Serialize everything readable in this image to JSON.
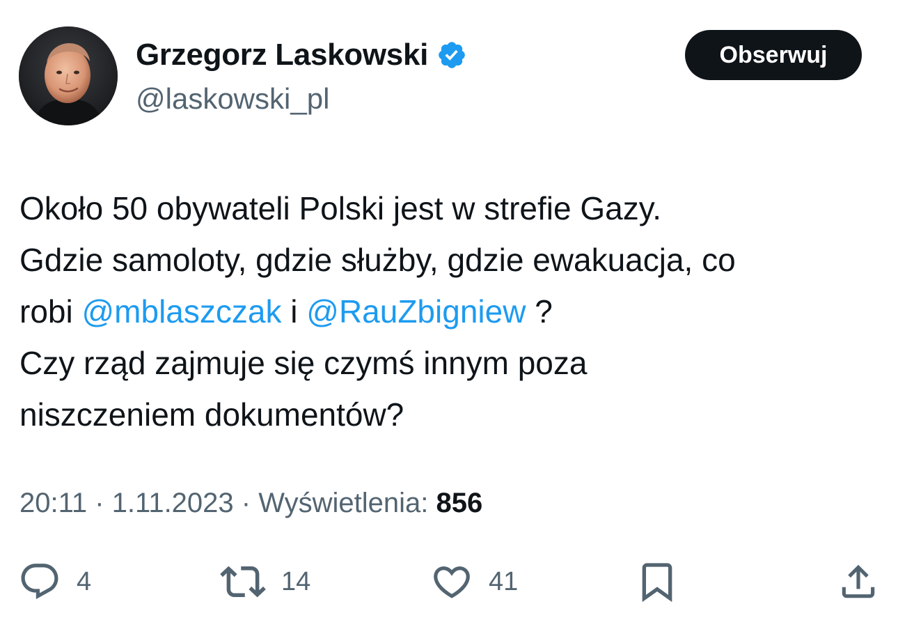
{
  "author": {
    "display_name": "Grzegorz Laskowski",
    "handle": "@laskowski_pl",
    "verified": true,
    "verified_color": "#1d9bf0"
  },
  "follow_button": {
    "label": "Obserwuj"
  },
  "tweet": {
    "line1": "Około 50 obywateli Polski jest w strefie Gazy.",
    "line2": "Gdzie samoloty, gdzie służby, gdzie ewakuacja, co",
    "line3_prefix": "robi ",
    "mention1": "@mblaszczak",
    "line3_middle": " i ",
    "mention2": "@RauZbigniew",
    "line3_suffix": " ?",
    "line4": "Czy rząd zajmuje się czymś innym poza",
    "line5": "niszczeniem dokumentów?"
  },
  "meta": {
    "time": "20:11",
    "separator1": " · ",
    "date": "1.11.2023",
    "separator2": " · ",
    "views_label": "Wyświetlenia: ",
    "views_count": "856"
  },
  "actions": {
    "reply": {
      "icon": "reply-icon",
      "count": "4"
    },
    "retweet": {
      "icon": "retweet-icon",
      "count": "14"
    },
    "like": {
      "icon": "heart-icon",
      "count": "41"
    },
    "bookmark": {
      "icon": "bookmark-icon"
    },
    "share": {
      "icon": "share-icon"
    }
  },
  "colors": {
    "text_primary": "#0f1419",
    "text_secondary": "#536471",
    "link": "#1d9bf0",
    "button_bg": "#0f1419"
  }
}
